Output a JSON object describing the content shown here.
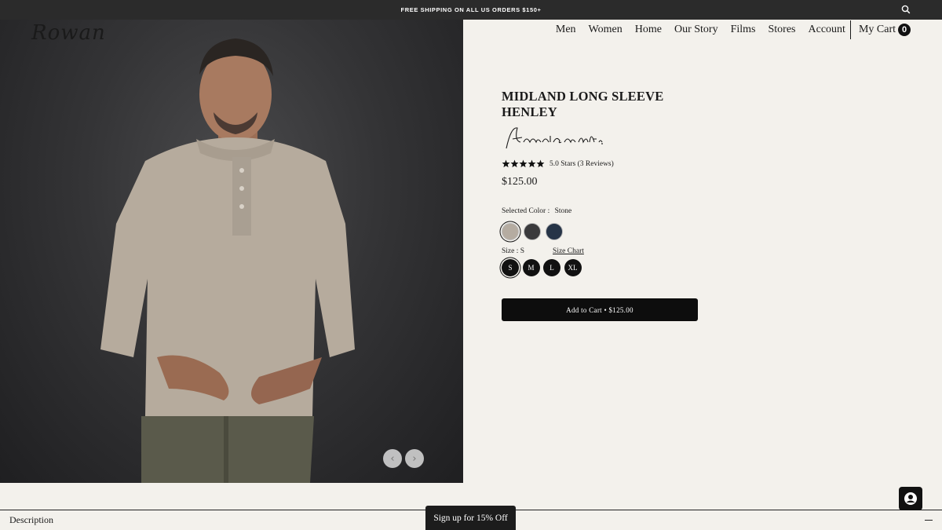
{
  "promo": {
    "text": "FREE SHIPPING ON ALL US ORDERS $150+"
  },
  "brand": {
    "logo": "Rowan"
  },
  "nav": {
    "items": [
      "Men",
      "Women",
      "Home",
      "Our Story",
      "Films",
      "Stores",
      "Account"
    ],
    "cart_label": "My Cart",
    "cart_count": "0"
  },
  "product": {
    "title": "MIDLAND LONG SLEEVE HENLEY",
    "made_label": "American made.",
    "rating_text": "5.0 Stars (3 Reviews)",
    "rating": 5,
    "price": "$125.00",
    "color_label": "Selected Color :",
    "selected_color": "Stone",
    "colors": [
      {
        "name": "Stone",
        "hex": "#b5aca1",
        "selected": true
      },
      {
        "name": "Charcoal",
        "hex": "#3a3a3c",
        "selected": false
      },
      {
        "name": "Navy",
        "hex": "#263447",
        "selected": false
      }
    ],
    "size_label": "Size : S",
    "size_chart": "Size Chart",
    "sizes": [
      {
        "label": "S",
        "selected": true
      },
      {
        "label": "M",
        "selected": false
      },
      {
        "label": "L",
        "selected": false
      },
      {
        "label": "XL",
        "selected": false
      }
    ],
    "add_to_cart": "Add to Cart • $125.00"
  },
  "carousel": {
    "prev_icon": "chevron-left-icon",
    "next_icon": "chevron-right-icon"
  },
  "description": {
    "label": "Description"
  },
  "signup": {
    "label": "Sign up for 15% Off"
  },
  "colors": {
    "promo_bg": "#2b2b2b",
    "page_bg": "#f3f1ec",
    "button_bg": "#0d0d0d"
  }
}
